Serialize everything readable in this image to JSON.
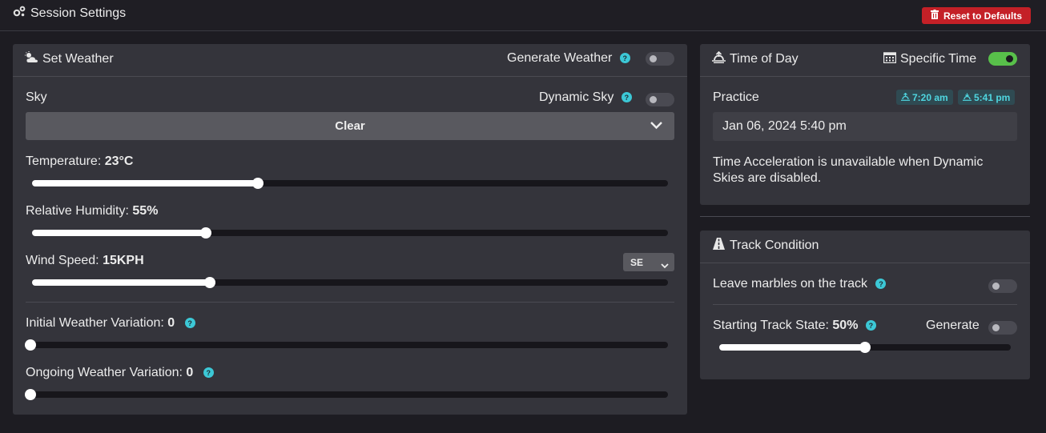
{
  "header": {
    "title": "Session Settings",
    "reset_label": "Reset to Defaults"
  },
  "weather": {
    "title": "Set Weather",
    "generate_label": "Generate Weather",
    "generate_on": false,
    "sky_label": "Sky",
    "dynamic_sky_label": "Dynamic Sky",
    "dynamic_sky_on": false,
    "sky_value": "Clear",
    "temperature": {
      "label": "Temperature:",
      "value": "23°C",
      "fraction": 0.355
    },
    "humidity": {
      "label": "Relative Humidity:",
      "value": "55%",
      "fraction": 0.273
    },
    "wind": {
      "label": "Wind Speed:",
      "value": "15KPH",
      "fraction": 0.28,
      "direction": "SE"
    },
    "initial_variation": {
      "label": "Initial Weather Variation:",
      "value": "0",
      "fraction": 0
    },
    "ongoing_variation": {
      "label": "Ongoing Weather Variation:",
      "value": "0",
      "fraction": 0
    }
  },
  "time": {
    "title": "Time of Day",
    "specific_label": "Specific Time",
    "specific_on": true,
    "session_label": "Practice",
    "sunrise": "7:20 am",
    "sunset": "5:41 pm",
    "datetime": "Jan 06, 2024 5:40 pm",
    "note": "Time Acceleration is unavailable when Dynamic Skies are disabled."
  },
  "track": {
    "title": "Track Condition",
    "marbles_label": "Leave marbles on the track",
    "marbles_on": false,
    "state_label": "Starting Track State:",
    "state_value": "50%",
    "state_fraction": 0.5,
    "generate_label": "Generate",
    "generate_on": false
  },
  "colors": {
    "background": "#1d1c22",
    "card": "#34343b",
    "accent_help": "#3cc8d6",
    "toggle_on": "#58c04a",
    "danger": "#c42027"
  }
}
